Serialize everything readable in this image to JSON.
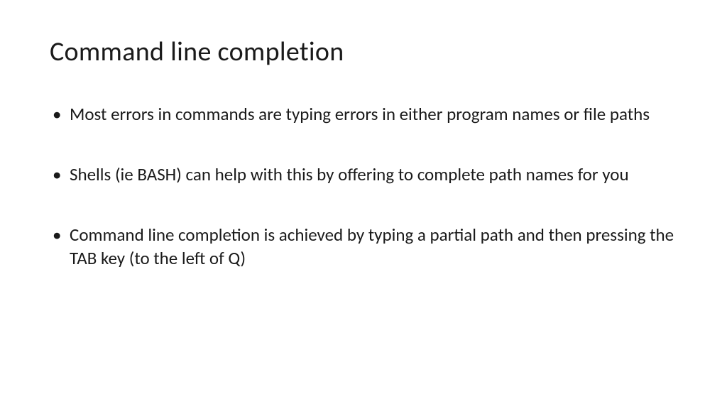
{
  "slide": {
    "title": "Command line completion",
    "bullets": [
      "Most errors in commands are typing errors in either program names or file paths",
      "Shells (ie BASH) can help with this by offering to complete path names for you",
      "Command line completion is achieved by typing a partial path and then pressing the TAB key (to the left of Q)"
    ]
  }
}
